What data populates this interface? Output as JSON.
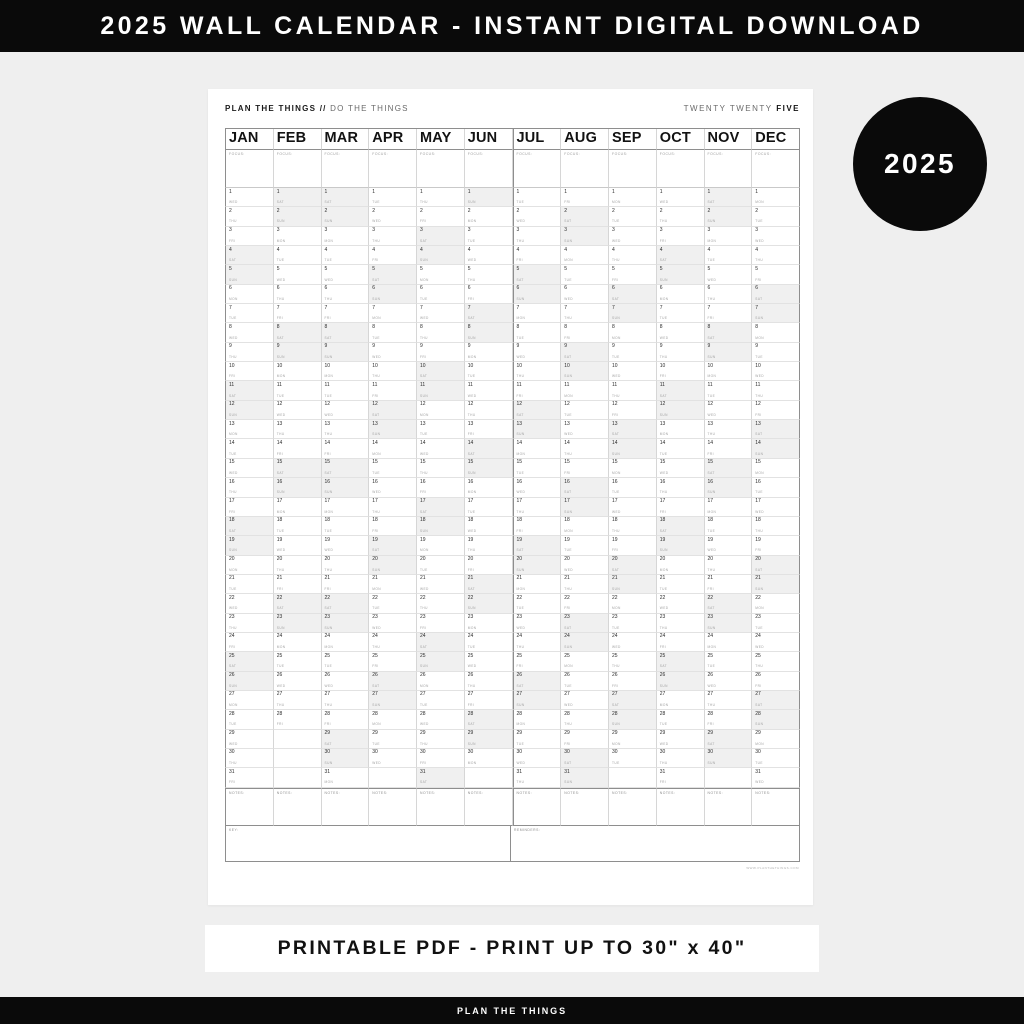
{
  "top_banner": {
    "text": "2025 WALL CALENDAR - INSTANT DIGITAL DOWNLOAD"
  },
  "pdf_banner": {
    "text": "PRINTABLE PDF - PRINT UP TO 30\" x 40\""
  },
  "bottom_banner": {
    "text": "PLAN THE THINGS"
  },
  "year_badge": {
    "text": "2025"
  },
  "sheet": {
    "brand_bold": "PLAN THE THINGS",
    "brand_slash": "//",
    "brand_light": "DO THE THINGS",
    "year_words_light": "TWENTY TWENTY",
    "year_words_bold": "FIVE",
    "focus_label": "FOCUS:",
    "notes_label": "NOTES:",
    "key_label": "KEY:",
    "reminders_label": "REMINDERS:",
    "url": "WWW.PLANTHETHINGS.COM"
  },
  "colors": {
    "banner_bg": "#0a0a0a",
    "banner_fg": "#ffffff",
    "page_bg": "#efefef",
    "sheet_bg": "#ffffff",
    "weekend_shade": "#f0f0f0",
    "grid_line": "#d6d6d6",
    "grid_line_strong": "#8e8e8e"
  },
  "calendar": {
    "year": 2025,
    "day_count": 31,
    "midyear_split_before": "JUL",
    "dow_names": [
      "SUN",
      "MON",
      "TUE",
      "WED",
      "THU",
      "FRI",
      "SAT"
    ],
    "months": [
      {
        "abbr": "JAN",
        "days": 31,
        "first_dow": 3
      },
      {
        "abbr": "FEB",
        "days": 28,
        "first_dow": 6
      },
      {
        "abbr": "MAR",
        "days": 31,
        "first_dow": 6
      },
      {
        "abbr": "APR",
        "days": 30,
        "first_dow": 2
      },
      {
        "abbr": "MAY",
        "days": 31,
        "first_dow": 4
      },
      {
        "abbr": "JUN",
        "days": 30,
        "first_dow": 0
      },
      {
        "abbr": "JUL",
        "days": 31,
        "first_dow": 2
      },
      {
        "abbr": "AUG",
        "days": 31,
        "first_dow": 5
      },
      {
        "abbr": "SEP",
        "days": 30,
        "first_dow": 1
      },
      {
        "abbr": "OCT",
        "days": 31,
        "first_dow": 3
      },
      {
        "abbr": "NOV",
        "days": 30,
        "first_dow": 6
      },
      {
        "abbr": "DEC",
        "days": 31,
        "first_dow": 1
      }
    ]
  }
}
